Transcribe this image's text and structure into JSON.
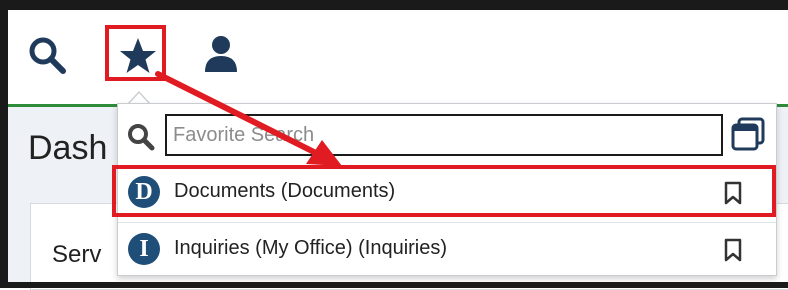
{
  "toolbar": {
    "search_icon": "search-icon",
    "favorites_icon": "star-icon",
    "user_icon": "user-icon"
  },
  "page": {
    "title": "Dash",
    "card_title": "Serv"
  },
  "favorites_dropdown": {
    "search_placeholder": "Favorite Search",
    "items": [
      {
        "badge": "D",
        "label": "Documents (Documents)"
      },
      {
        "badge": "I",
        "label": "Inquiries (My Office) (Inquiries)"
      }
    ]
  },
  "colors": {
    "highlight": "#e11b22",
    "badge": "#1f4e79",
    "icon": "#1f3a5a",
    "accent_line": "#2e8b3a"
  }
}
